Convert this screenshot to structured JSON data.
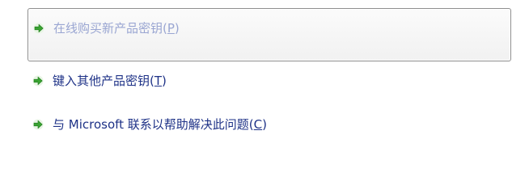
{
  "options": [
    {
      "label": "在线购买新产品密钥(",
      "accelerator": "P",
      "suffix": ")",
      "state": "selected",
      "icon": "green-arrow-icon"
    },
    {
      "label": "键入其他产品密钥(",
      "accelerator": "T",
      "suffix": ")",
      "state": "normal",
      "icon": "green-arrow-icon"
    },
    {
      "label": "与 Microsoft 联系以帮助解决此问题(",
      "accelerator": "C",
      "suffix": ")",
      "state": "normal",
      "icon": "green-arrow-icon"
    }
  ],
  "colors": {
    "link": "#1e3287",
    "link_selected": "#9aa6d2",
    "arrow_green": "#3aa332",
    "selection_border": "#8f8f8f"
  }
}
